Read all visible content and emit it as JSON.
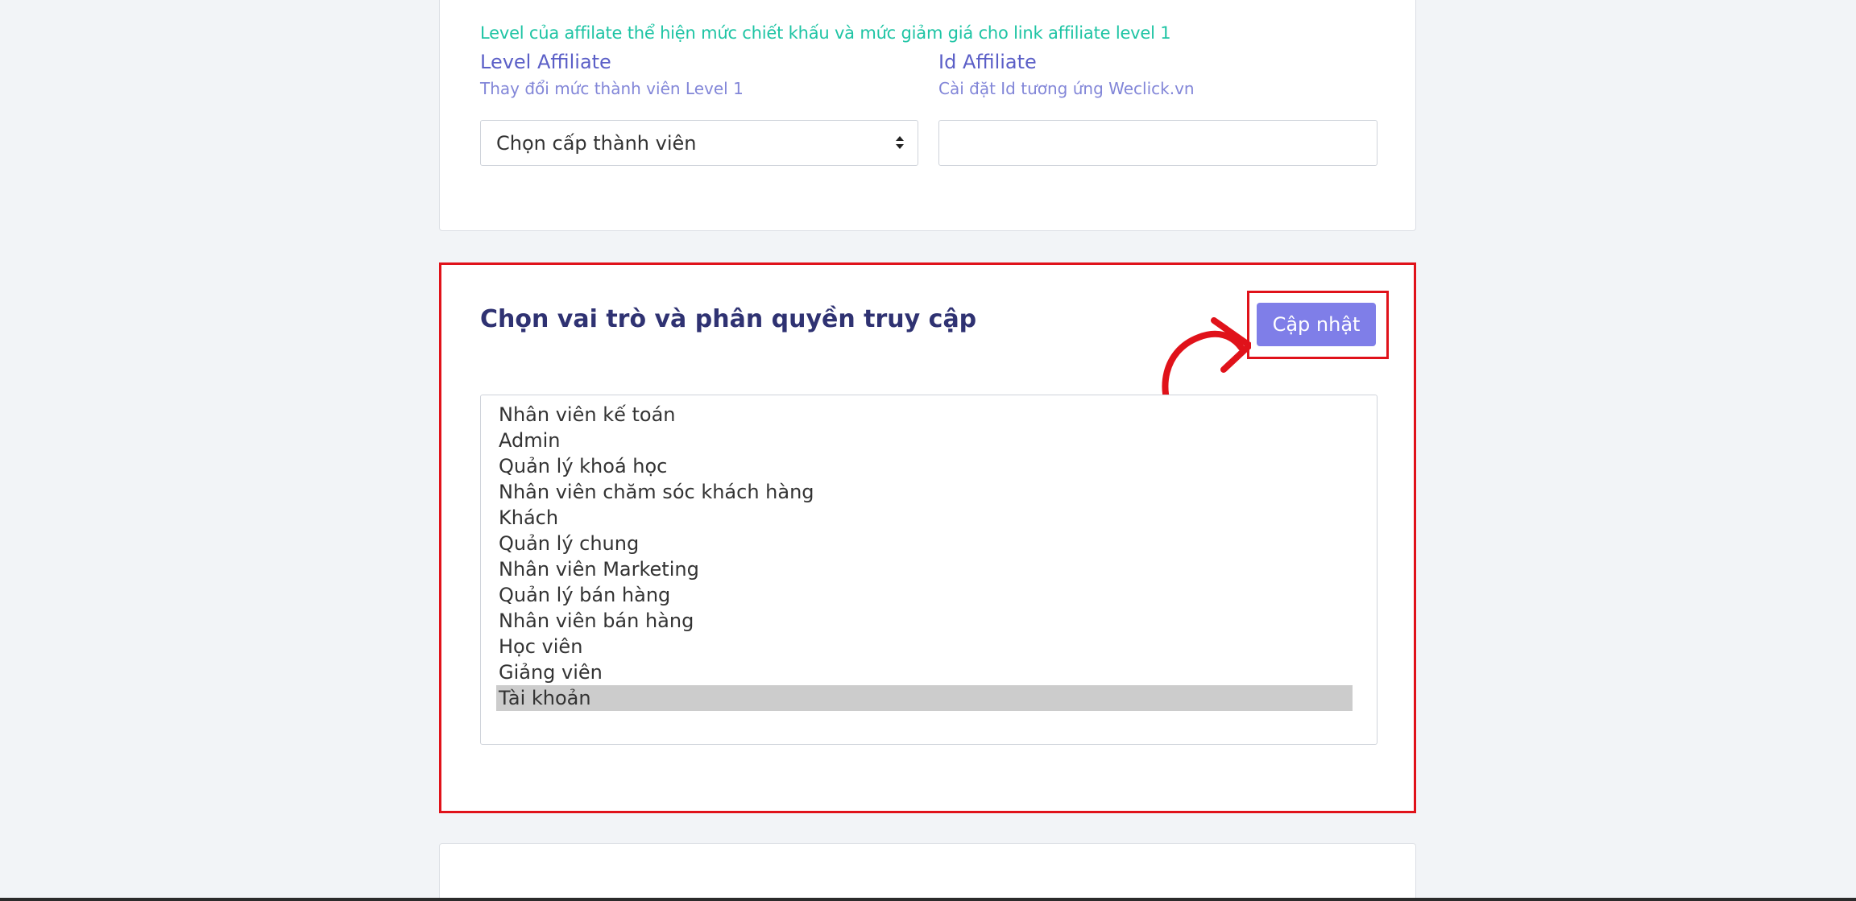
{
  "affiliate_card": {
    "note": "Level của affilate thể hiện mức chiết khấu và mức giảm giá cho link affiliate level 1",
    "level": {
      "title": "Level Affiliate",
      "subtitle": "Thay đổi mức thành viên Level 1",
      "select_value": "Chọn cấp thành viên"
    },
    "id": {
      "title": "Id Affiliate",
      "subtitle": "Cài đặt Id tương ứng Weclick.vn",
      "value": ""
    }
  },
  "roles_card": {
    "title": "Chọn vai trò và phân quyền truy cập",
    "update_button": "Cập nhật",
    "roles": [
      "Nhân viên kế toán",
      "Admin",
      "Quản lý khoá học",
      "Nhân viên chăm sóc khách hàng",
      "Khách",
      "Quản lý chung",
      "Nhân viên Marketing",
      "Quản lý bán hàng",
      "Nhân viên bán hàng",
      "Học viên",
      "Giảng viên",
      "Tài khoản"
    ],
    "selected_role": "Tài khoản"
  },
  "colors": {
    "accent": "#7f7ee8",
    "highlight": "#e0121a",
    "note": "#1ec4a4"
  }
}
